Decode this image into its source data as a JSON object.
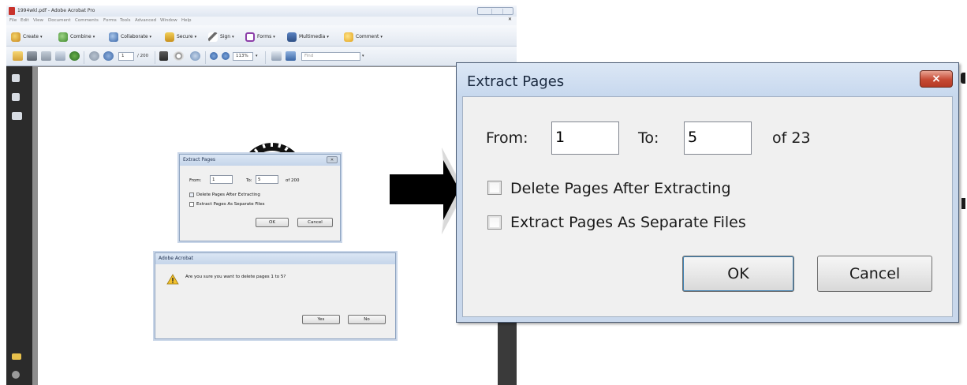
{
  "acrobat": {
    "window_title": "1994wkl.pdf - Adobe Acrobat Pro",
    "menu": [
      "File",
      "Edit",
      "View",
      "Document",
      "Comments",
      "Forms",
      "Tools",
      "Advanced",
      "Window",
      "Help"
    ],
    "toolbar": {
      "create": "Create",
      "combine": "Combine",
      "collaborate": "Collaborate",
      "secure": "Secure",
      "sign": "Sign",
      "forms": "Forms",
      "multimedia": "Multimedia",
      "comment": "Comment"
    },
    "nav": {
      "page_current": "1",
      "page_total": "/ 200",
      "zoom": "113%",
      "find_placeholder": "Find"
    }
  },
  "small_dialog": {
    "title": "Extract Pages",
    "from_label": "From:",
    "from_value": "1",
    "to_label": "To:",
    "to_value": "5",
    "of_label": "of 200",
    "delete_label": "Delete Pages After Extracting",
    "separate_label": "Extract Pages As Separate Files",
    "ok": "OK",
    "cancel": "Cancel"
  },
  "confirm_dialog": {
    "title": "Adobe Acrobat",
    "message": "Are you sure you want to delete pages 1 to 5?",
    "yes": "Yes",
    "no": "No"
  },
  "extract_dialog": {
    "title": "Extract Pages",
    "close": "×",
    "from_label": "From:",
    "from_value": "1",
    "to_label": "To:",
    "to_value": "5",
    "of_label": "of 23",
    "delete_label": "Delete Pages After Extracting",
    "delete_checked": false,
    "separate_label": "Extract Pages As Separate Files",
    "separate_checked": false,
    "ok": "OK",
    "cancel": "Cancel"
  },
  "colors": {
    "title_gradient_top": "#dce7f5",
    "close_button": "#c64a34",
    "dialog_body": "#f0f0f0"
  }
}
